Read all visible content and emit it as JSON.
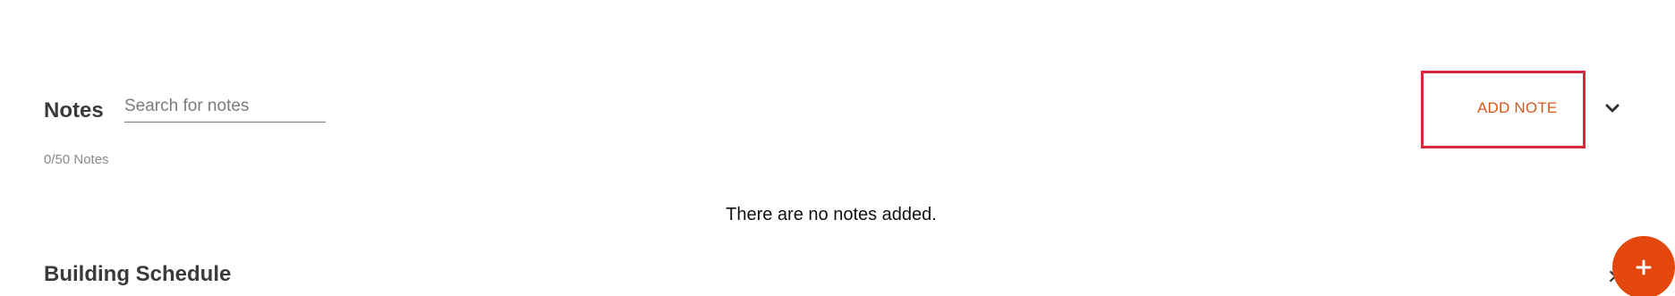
{
  "notes": {
    "title": "Notes",
    "search_placeholder": "Search for notes",
    "count_text": "0/50 Notes",
    "add_note_label": "ADD NOTE",
    "empty_message": "There are no notes added."
  },
  "building_schedule": {
    "title": "Building Schedule"
  },
  "colors": {
    "accent": "#e4470e",
    "highlight_border": "#d5283a",
    "add_note_text": "#d35a1a"
  },
  "icons": {
    "dropdown": "chevron-down-icon",
    "fab": "plus-icon",
    "close": "close-icon"
  }
}
